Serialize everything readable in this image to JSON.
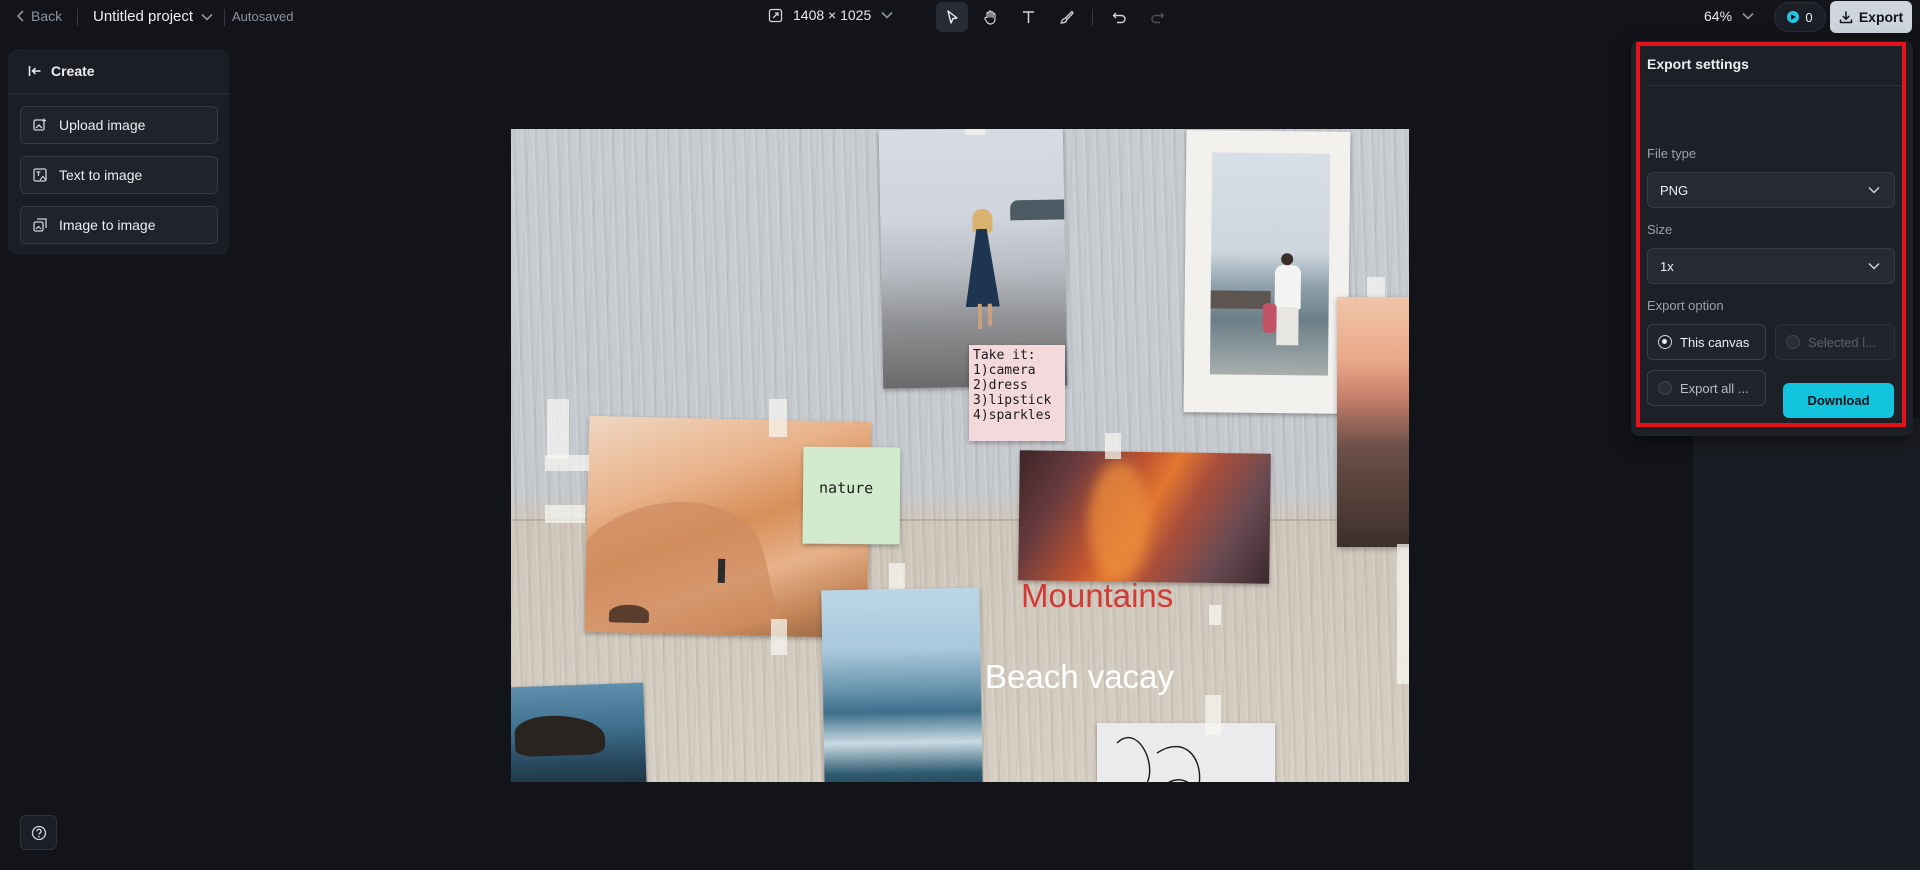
{
  "topbar": {
    "back_label": "Back",
    "project_name": "Untitled project",
    "autosave_status": "Autosaved",
    "canvas_size": "1408 × 1025",
    "zoom": "64%",
    "credits": "0",
    "export_label": "Export",
    "tools": [
      "select-icon",
      "hand-icon",
      "text-icon",
      "brush-icon",
      "undo-icon",
      "redo-icon"
    ]
  },
  "left_panel": {
    "title": "Create",
    "items": [
      {
        "label": "Upload image",
        "icon": "upload-image-icon"
      },
      {
        "label": "Text to image",
        "icon": "text-to-image-icon"
      },
      {
        "label": "Image to image",
        "icon": "image-to-image-icon"
      }
    ]
  },
  "canvas": {
    "note_text": "Take it:\n1)camera\n2)dress\n3)lipstick\n4)sparkles",
    "sticky_text": "nature",
    "label_mountains": "Mountains",
    "label_beach": "Beach vacay",
    "colors": {
      "mountains": "#d03b36",
      "beach": "#ffffff"
    }
  },
  "export_settings": {
    "title": "Export settings",
    "file_type_label": "File type",
    "file_type_value": "PNG",
    "size_label": "Size",
    "size_value": "1x",
    "export_option_label": "Export option",
    "options": [
      {
        "label": "This canvas",
        "selected": true,
        "enabled": true
      },
      {
        "label": "Selected l...",
        "selected": false,
        "enabled": false
      },
      {
        "label": "Export all ...",
        "selected": false,
        "enabled": true
      }
    ],
    "download_label": "Download",
    "accent_color": "#13c4df",
    "highlight_color": "#e3121b"
  }
}
